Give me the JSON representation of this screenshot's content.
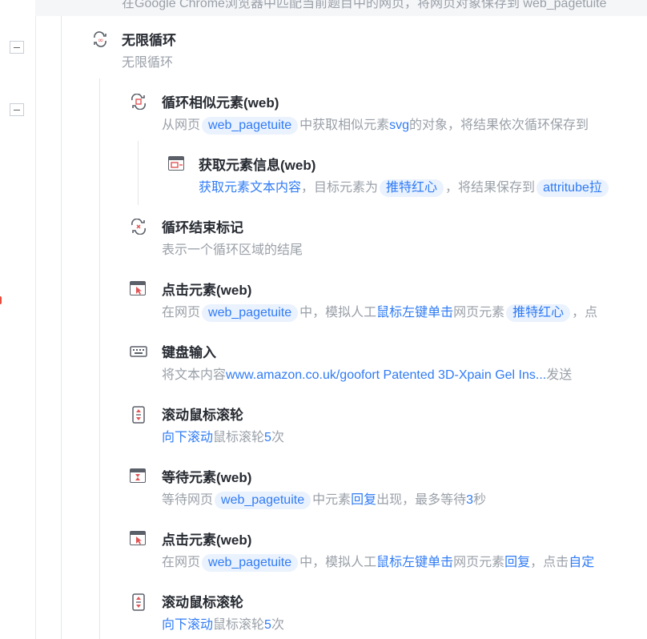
{
  "topbar_text": "在Google Chrome浏览器中匹配当前题目中的网页，将网页对象保存到 web_pagetuite",
  "loop": {
    "title": "无限循环",
    "desc": "无限循环"
  },
  "steps": [
    {
      "title": "循环相似元素(web)",
      "desc": {
        "p1": "从网页",
        "tag1": "web_pagetuite",
        "p2": "中获取相似元素",
        "lk1": "svg",
        "p3": "的对象，将结果依次循环保存到"
      }
    },
    {
      "title": "获取元素信息(web)",
      "desc": {
        "lk1": "获取元素文本内容",
        "p1": "，目标元素为",
        "tag1": "推特红心",
        "p2": "，将结果保存到",
        "tag2": "attritube拉"
      }
    },
    {
      "title": "循环结束标记",
      "desc": {
        "p1": "表示一个循环区域的结尾"
      }
    },
    {
      "title": "点击元素(web)",
      "desc": {
        "p1": "在网页",
        "tag1": "web_pagetuite",
        "p2": "中，模拟人工",
        "lk1": "鼠标左键单击",
        "p3": "网页元素",
        "tag2": "推特红心",
        "p4": "，点"
      }
    },
    {
      "title": "键盘输入",
      "desc": {
        "p1": "将文本内容",
        "lk1": "www.amazon.co.uk/goofort Patented 3D-Xpain Gel Ins...",
        "p2": "发送"
      }
    },
    {
      "title": "滚动鼠标滚轮",
      "desc": {
        "lk1": "向下滚动",
        "p1": "鼠标滚轮",
        "lk2": "5",
        "p2": "次"
      }
    },
    {
      "title": "等待元素(web)",
      "desc": {
        "p1": "等待网页",
        "tag1": "web_pagetuite",
        "p2": "中元素",
        "lk1": "回复",
        "p3": "出现，最多等待",
        "lk2": "3",
        "p4": "秒"
      }
    },
    {
      "title": "点击元素(web)",
      "desc": {
        "p1": "在网页",
        "tag1": "web_pagetuite",
        "p2": "中，模拟人工",
        "lk1": "鼠标左键单击",
        "p3": "网页元素",
        "lk2": "回复",
        "p4": "，点击",
        "lk3": "自定"
      }
    },
    {
      "title": "滚动鼠标滚轮",
      "desc": {
        "lk1": "向下滚动",
        "p1": "鼠标滚轮",
        "lk2": "5",
        "p2": "次"
      }
    }
  ]
}
